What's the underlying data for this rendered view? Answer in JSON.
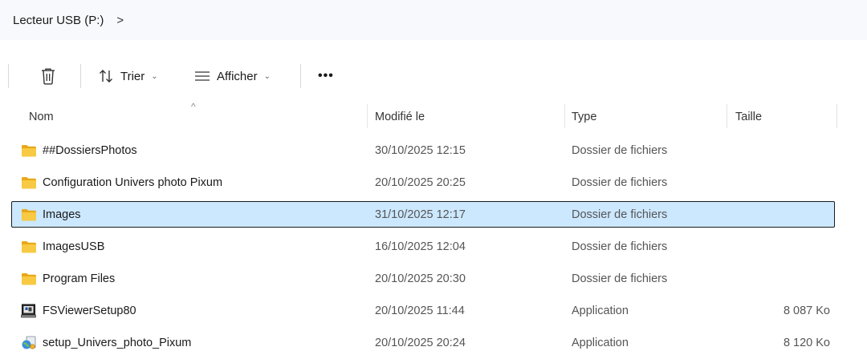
{
  "address": {
    "crumbs": [
      {
        "label": "Lecteur USB (P:)"
      }
    ],
    "separator": ">"
  },
  "toolbar": {
    "delete_icon": "trash-icon",
    "sort_label": "Trier",
    "sort_icon": "sort-arrows-icon",
    "view_label": "Afficher",
    "view_icon": "list-lines-icon",
    "more_label": "•••"
  },
  "columns": {
    "name": "Nom",
    "modified": "Modifié le",
    "type": "Type",
    "size": "Taille",
    "sort_indicator": "^"
  },
  "files": [
    {
      "name": "##DossiersPhotos",
      "modified": "30/10/2025 12:15",
      "type": "Dossier de fichiers",
      "size": "",
      "icon": "folder-icon",
      "selected": false
    },
    {
      "name": "Configuration Univers photo Pixum",
      "modified": "20/10/2025 20:25",
      "type": "Dossier de fichiers",
      "size": "",
      "icon": "folder-icon",
      "selected": false
    },
    {
      "name": "Images",
      "modified": "31/10/2025 12:17",
      "type": "Dossier de fichiers",
      "size": "",
      "icon": "folder-icon",
      "selected": true
    },
    {
      "name": "ImagesUSB",
      "modified": "16/10/2025 12:04",
      "type": "Dossier de fichiers",
      "size": "",
      "icon": "folder-icon",
      "selected": false
    },
    {
      "name": "Program Files",
      "modified": "20/10/2025 20:30",
      "type": "Dossier de fichiers",
      "size": "",
      "icon": "folder-icon",
      "selected": false
    },
    {
      "name": "FSViewerSetup80",
      "modified": "20/10/2025 11:44",
      "type": "Application",
      "size": "8 087 Ko",
      "icon": "installer-icon",
      "selected": false
    },
    {
      "name": "setup_Univers_photo_Pixum",
      "modified": "20/10/2025 20:24",
      "type": "Application",
      "size": "8 120 Ko",
      "icon": "setup-globe-icon",
      "selected": false
    }
  ],
  "colors": {
    "selection_bg": "#cce8ff",
    "folder_yellow": "#f5c542",
    "address_bg": "#f7f9fc"
  }
}
